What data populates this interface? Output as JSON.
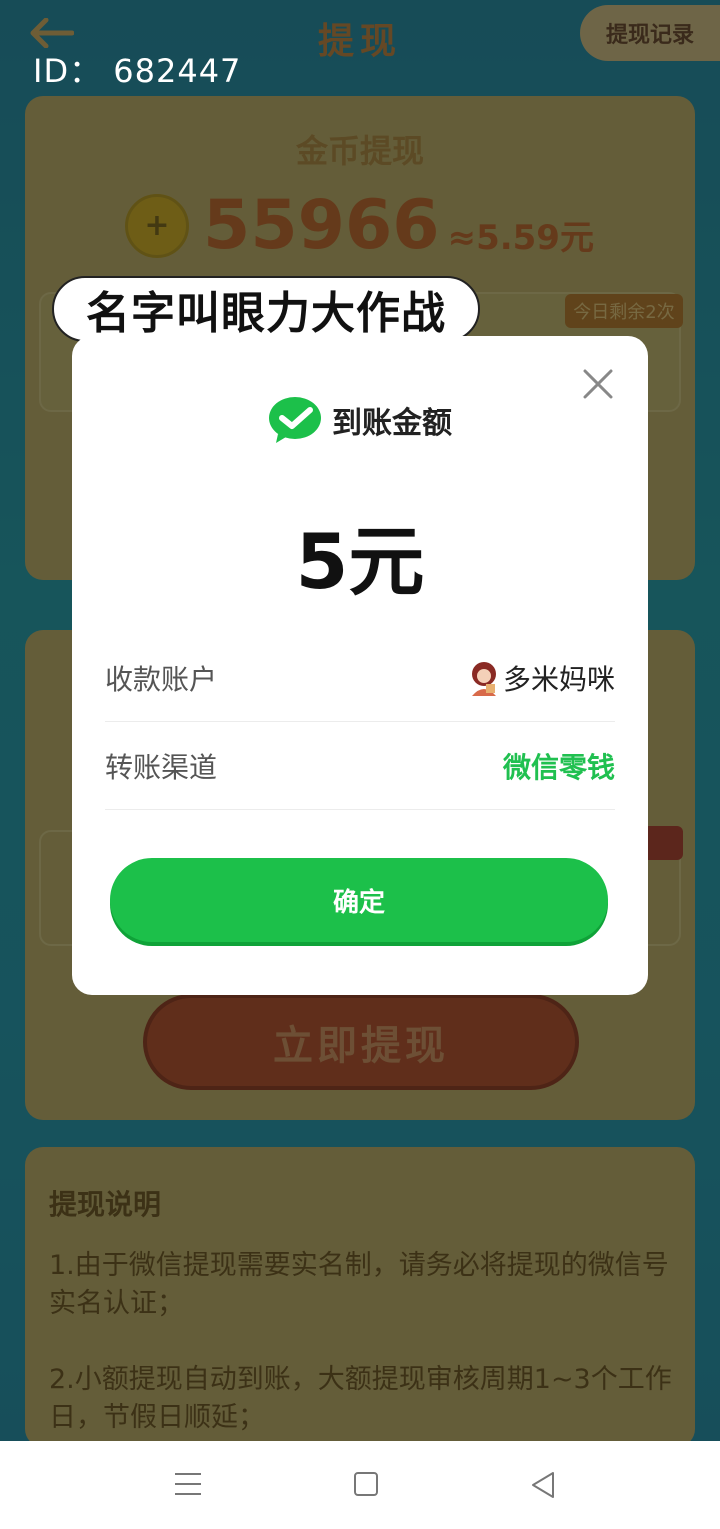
{
  "user_id": "ID：  682447",
  "background": {
    "title": "提现",
    "records_button": "提现记录",
    "coin_card": {
      "title": "金币提现",
      "coin_balance": "55966",
      "approx_value": "≈5.59元",
      "daily_badge": "今日剩余2次"
    },
    "withdraw_button": "立即提现",
    "explain": {
      "title": "提现说明",
      "items": [
        "1.由于微信提现需要实名制，请务必将提现的微信号实名认证；",
        "2.小额提现自动到账，大额提现审核周期1~3个工作日，节假日顺延；"
      ]
    }
  },
  "bubble_text": "名字叫眼力大作战",
  "modal": {
    "heading": "到账金额",
    "amount": "5元",
    "rows": [
      {
        "label": "收款账户",
        "value": "多米妈咪"
      },
      {
        "label": "转账渠道",
        "value": "微信零钱"
      }
    ],
    "confirm_label": "确定"
  },
  "colors": {
    "wechat_green": "#1cc04a",
    "channel_green": "#20c050"
  },
  "icons": [
    "back-arrow-icon",
    "coin-icon",
    "close-icon",
    "wechat-check-icon",
    "avatar-icon",
    "menu-icon",
    "home-icon",
    "back-triangle-icon"
  ]
}
